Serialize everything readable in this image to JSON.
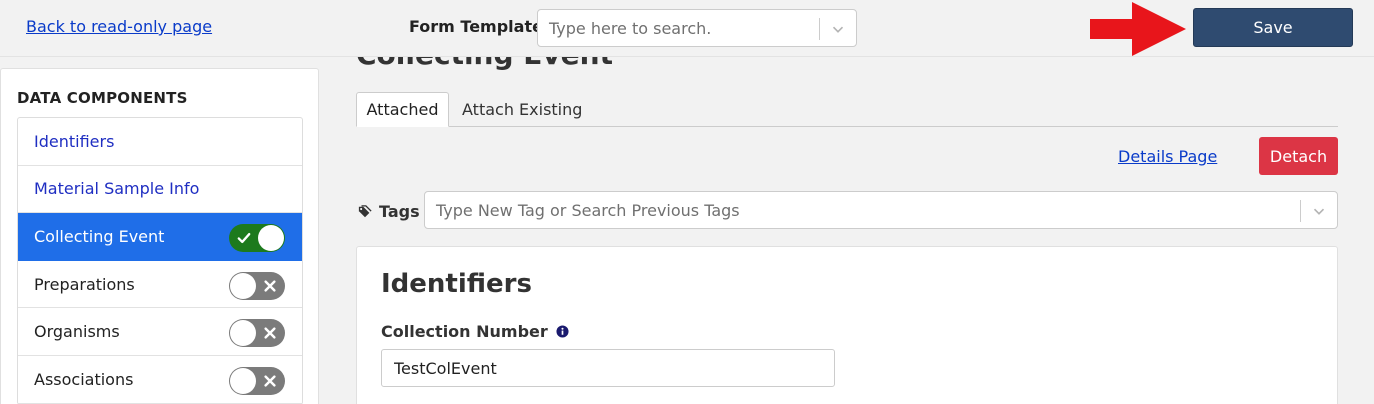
{
  "header": {
    "back_link": "Back to read-only page",
    "form_template_label": "Form Template",
    "form_template_placeholder": "Type here to search.",
    "save_label": "Save"
  },
  "sidebar": {
    "title": "DATA COMPONENTS",
    "items": [
      {
        "label": "Identifiers"
      },
      {
        "label": "Material Sample Info"
      },
      {
        "label": "Collecting Event",
        "toggle": "on"
      },
      {
        "label": "Preparations",
        "toggle": "off"
      },
      {
        "label": "Organisms",
        "toggle": "off"
      },
      {
        "label": "Associations",
        "toggle": "off"
      }
    ]
  },
  "main": {
    "section_title": "Collecting Event",
    "tabs": [
      "Attached",
      "Attach Existing"
    ],
    "details_link": "Details Page",
    "detach_label": "Detach",
    "tags_label": "Tags",
    "tags_placeholder": "Type New Tag or Search Previous Tags",
    "card": {
      "title": "Identifiers",
      "field_label": "Collection Number",
      "field_value": "TestColEvent"
    }
  },
  "colors": {
    "save_button": "#2f4b70",
    "active_item": "#1f6ee8",
    "toggle_on": "#1d7a1d",
    "toggle_off": "#7b7b7b",
    "detach_button": "#dc3545",
    "link": "#0a3bc9",
    "annotation_arrow": "#e8151b"
  }
}
